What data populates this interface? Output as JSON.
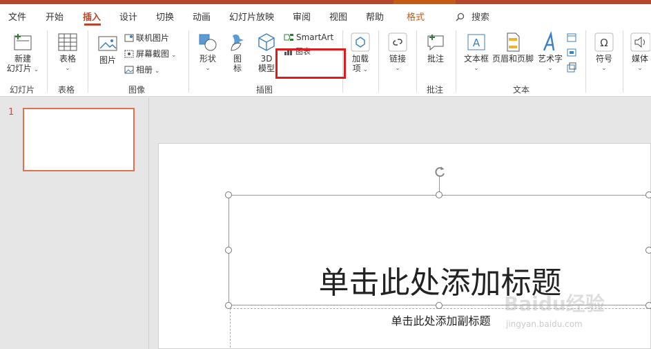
{
  "tabs": [
    "文件",
    "开始",
    "插入",
    "设计",
    "切换",
    "动画",
    "幻灯片放映",
    "审阅",
    "视图",
    "帮助",
    "格式"
  ],
  "active_tab": "插入",
  "search_label": "搜索",
  "ribbon": {
    "new_slide": "新建\n幻灯片",
    "new_slide_l1": "新建",
    "new_slide_l2": "幻灯片",
    "table": "表格",
    "picture": "图片",
    "online_picture": "联机图片",
    "screenshot": "屏幕截图",
    "album": "相册",
    "shapes": "形状",
    "icons_l1": "图",
    "icons_l2": "标",
    "model_l1": "3D",
    "model_l2": "模型",
    "smartart": "SmartArt",
    "chart": "图表",
    "addins_l1": "加载",
    "addins_l2": "项",
    "link": "链接",
    "comment": "批注",
    "textbox": "文本框",
    "header_footer": "页眉和页脚",
    "wordart": "艺术字",
    "symbol": "符号",
    "media": "媒体",
    "groups": {
      "slides": "幻灯片",
      "tables": "表格",
      "images": "图像",
      "illustrations": "插图",
      "comments": "批注",
      "text": "文本"
    }
  },
  "slide_number": "1",
  "slide": {
    "title_placeholder": "单击此处添加标题",
    "subtitle_placeholder": "单击此处添加副标题"
  },
  "watermark": {
    "logo": "Baidu经验",
    "url": "jingyan.baidu.com"
  },
  "colors": {
    "accent": "#b7472a",
    "highlight_box": "#e01b1b",
    "format_tab": "#c55a11"
  }
}
